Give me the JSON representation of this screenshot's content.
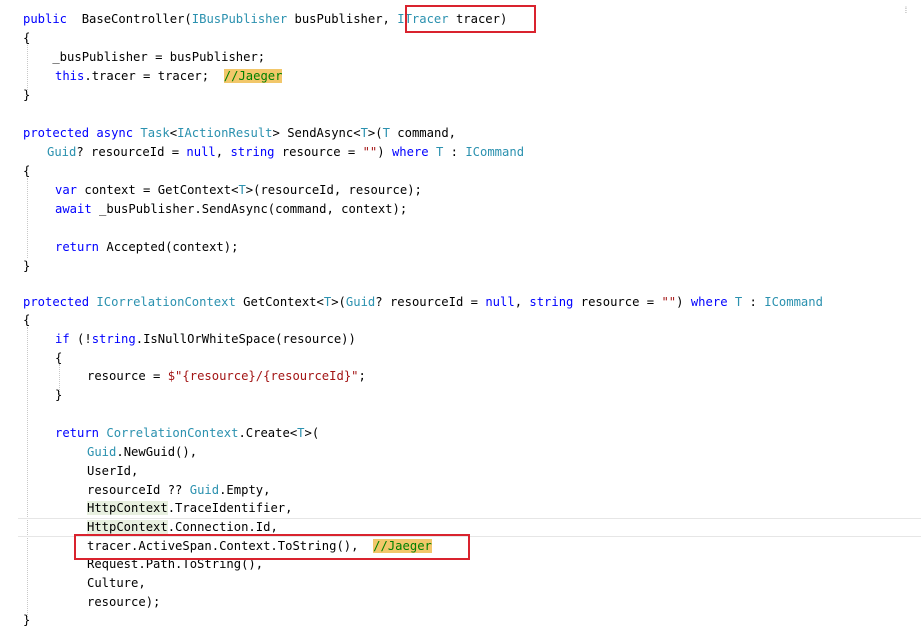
{
  "editor": {
    "language": "C#",
    "colors": {
      "keyword": "#0000ff",
      "type": "#2b91af",
      "string": "#a31515",
      "comment": "#008000",
      "highlight_box": "#d9232e",
      "comment_highlight": "#f2c76a"
    },
    "code": {
      "l1a": "public",
      "l1b": " BaseController(",
      "l1c": "IBusPublisher",
      "l1d": " busPublisher, ",
      "l1e": "ITracer",
      "l1f": " tracer)",
      "l2": "{",
      "l3": "    _busPublisher = busPublisher;",
      "l4a": "this",
      "l4b": ".tracer = tracer;  ",
      "l4c": "//Jaeger",
      "l5": "}",
      "l7a": "protected",
      "l7b": "async",
      "l7c": "Task",
      "l7d": "<",
      "l7e": "IActionResult",
      "l7f": "> SendAsync<",
      "l7g": "T",
      "l7h": ">(",
      "l7i": "T",
      "l7j": " command,",
      "l8a": "Guid",
      "l8b": "? resourceId = ",
      "l8c": "null",
      "l8d": ", ",
      "l8e": "string",
      "l8f": " resource = ",
      "l8g": "\"\"",
      "l8h": ") ",
      "l8i": "where",
      "l8j": "T",
      "l8k": " : ",
      "l8l": "ICommand",
      "l9": "{",
      "l10a": "var",
      "l10b": " context = GetContext<",
      "l10c": "T",
      "l10d": ">(resourceId, resource);",
      "l11a": "await",
      "l11b": " _busPublisher.SendAsync(command, context);",
      "l13a": "return",
      "l13b": " Accepted(context);",
      "l14": "}",
      "l16a": "protected",
      "l16b": "ICorrelationContext",
      "l16c": " GetContext<",
      "l16d": "T",
      "l16e": ">(",
      "l16f": "Guid",
      "l16g": "? resourceId = ",
      "l16h": "null",
      "l16i": ", ",
      "l16j": "string",
      "l16k": " resource = ",
      "l16l": "\"\"",
      "l16m": ") ",
      "l16n": "where",
      "l16o": "T",
      "l16p": " : ",
      "l16q": "ICommand",
      "l17": "{",
      "l18a": "if",
      "l18b": " (!",
      "l18c": "string",
      "l18d": ".IsNullOrWhiteSpace(resource))",
      "l19": "{",
      "l20a": "resource = ",
      "l20b": "$\"{resource}/{resourceId}\"",
      "l20c": ";",
      "l21": "}",
      "l23a": "return",
      "l23b": "CorrelationContext",
      "l23c": ".Create<",
      "l23d": "T",
      "l23e": ">(",
      "l24a": "Guid",
      "l24b": ".NewGuid(),",
      "l25": "UserId,",
      "l26a": "resourceId ?? ",
      "l26b": "Guid",
      "l26c": ".Empty,",
      "l27a": "HttpContext",
      "l27b": ".TraceIdentifier,",
      "l28a": "HttpContext",
      "l28b": ".Connection.Id,",
      "l29a": "tracer.ActiveSpan.Context.ToString(),  ",
      "l29b": "//Jaeger",
      "l30": "Request.Path.ToString(),",
      "l31": "Culture,",
      "l32": "resource);",
      "l33": "}"
    }
  }
}
